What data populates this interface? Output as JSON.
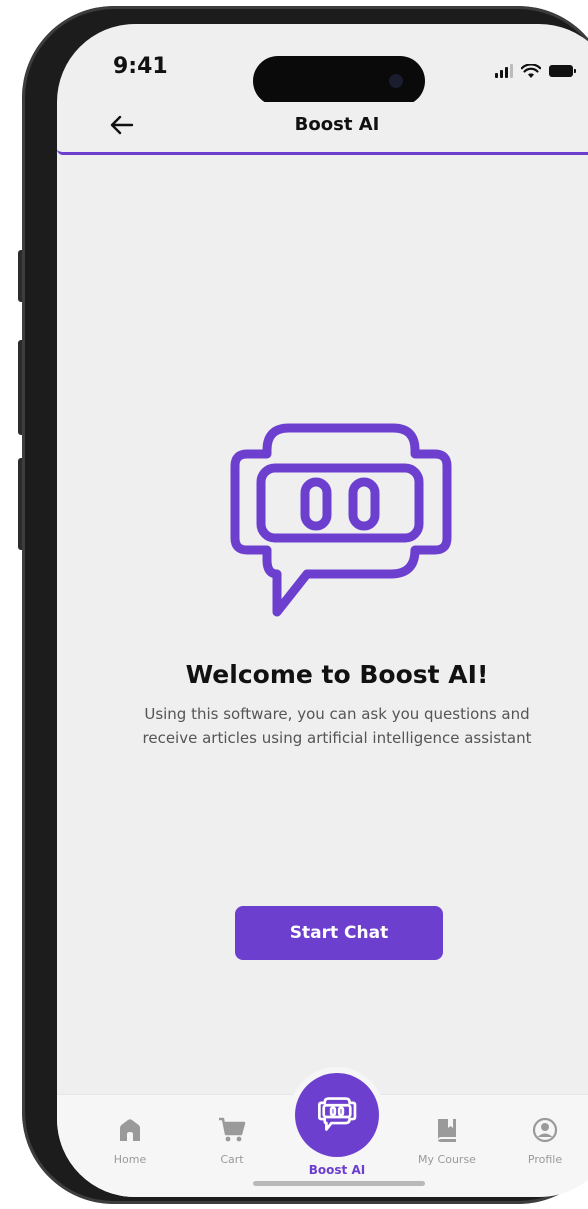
{
  "status_bar": {
    "time": "9:41"
  },
  "header": {
    "title": "Boost AI",
    "back_icon": "arrow-left-icon"
  },
  "hero": {
    "icon": "robot-chat-icon"
  },
  "welcome": {
    "title": "Welcome to Boost AI!",
    "description": "Using this software, you can ask you questions and receive articles using artificial intelligence assistant"
  },
  "actions": {
    "start_chat_label": "Start Chat"
  },
  "bottom_nav": {
    "items": [
      {
        "label": "Home",
        "icon": "home-icon",
        "active": false
      },
      {
        "label": "Cart",
        "icon": "cart-icon",
        "active": false
      },
      {
        "label": "Boost AI",
        "icon": "robot-icon",
        "active": true
      },
      {
        "label": "My Course",
        "icon": "book-icon",
        "active": false
      },
      {
        "label": "Profile",
        "icon": "profile-icon",
        "active": false
      }
    ]
  },
  "colors": {
    "accent": "#6c3fcf",
    "background": "#efeff0",
    "inactive": "#9a9a9a"
  }
}
